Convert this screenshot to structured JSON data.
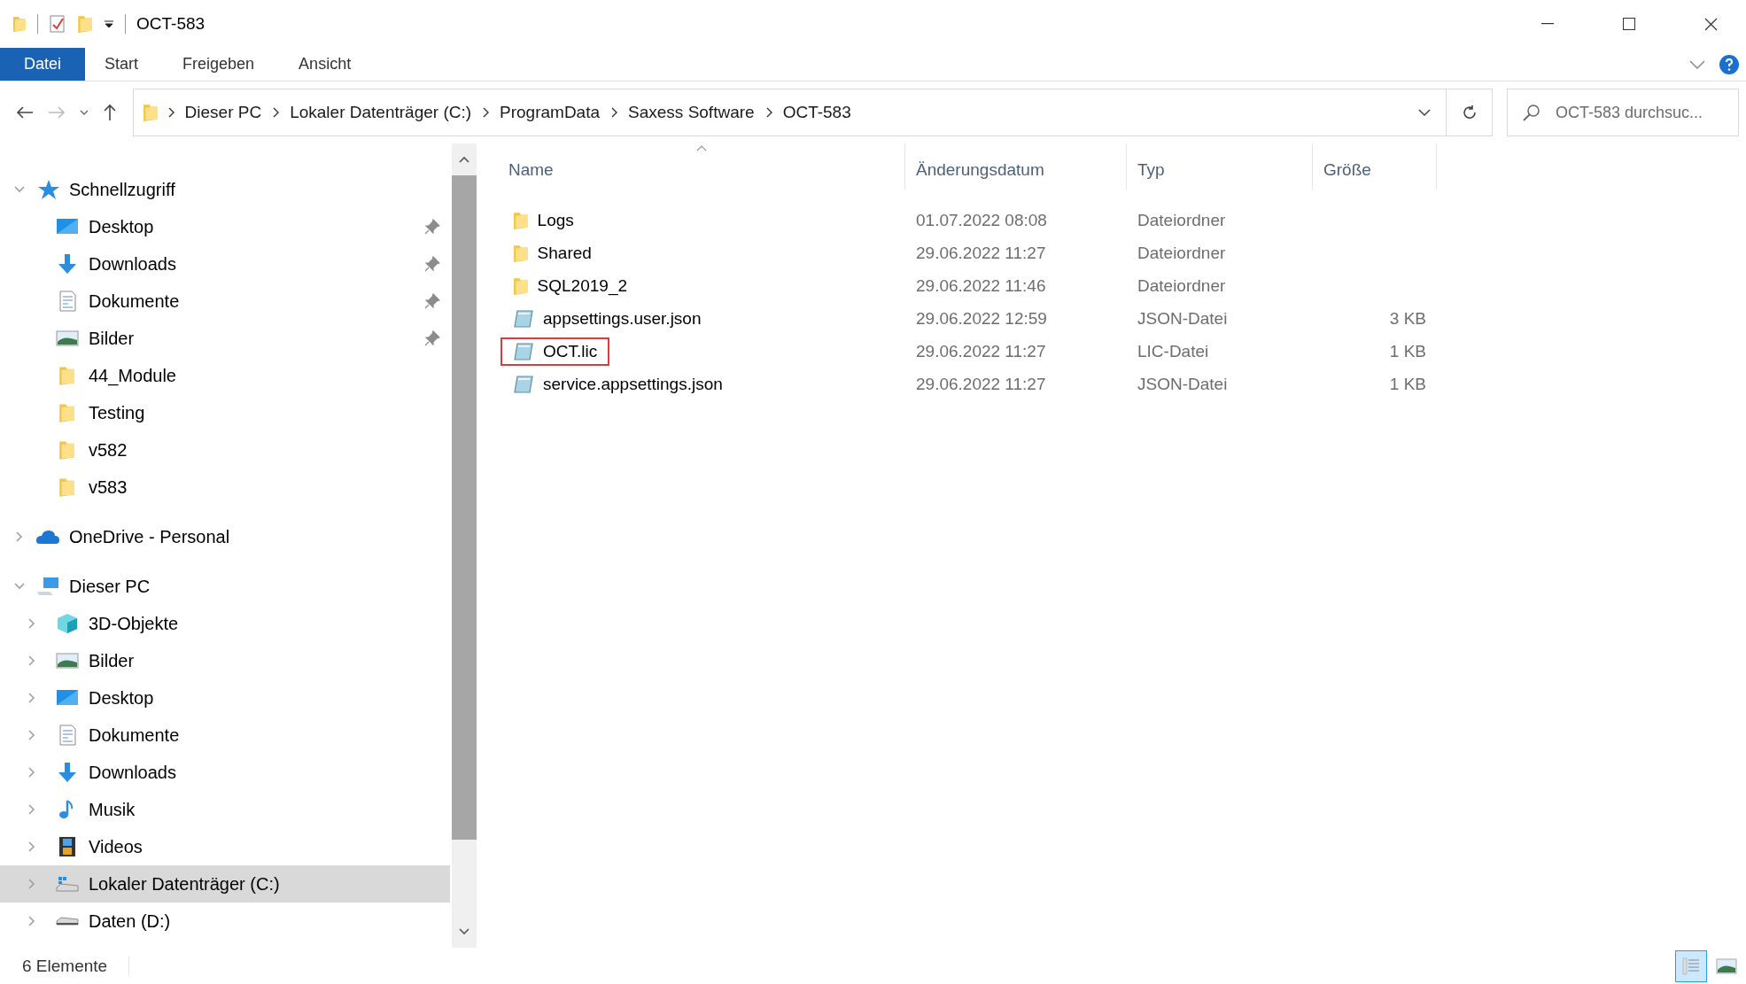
{
  "window": {
    "title": "OCT-583"
  },
  "ribbon_tabs": [
    {
      "label": "Datei",
      "kind": "file"
    },
    {
      "label": "Start",
      "kind": "tab"
    },
    {
      "label": "Freigeben",
      "kind": "tab"
    },
    {
      "label": "Ansicht",
      "kind": "tab"
    }
  ],
  "address_bar": {
    "segments": [
      "Dieser PC",
      "Lokaler Datenträger (C:)",
      "ProgramData",
      "Saxess Software",
      "OCT-583"
    ]
  },
  "search": {
    "placeholder": "OCT-583 durchsuc..."
  },
  "sidebar": {
    "items": [
      {
        "label": "Schnellzugriff",
        "kind": "star",
        "expanded": true,
        "selected": false,
        "children": [
          {
            "label": "Desktop",
            "kind": "desktop",
            "pinned": true,
            "selected": false
          },
          {
            "label": "Downloads",
            "kind": "downloads",
            "pinned": true,
            "selected": false
          },
          {
            "label": "Dokumente",
            "kind": "documents",
            "pinned": true,
            "selected": false
          },
          {
            "label": "Bilder",
            "kind": "pictures",
            "pinned": true,
            "selected": false
          },
          {
            "label": "44_Module",
            "kind": "folder",
            "pinned": false,
            "selected": false
          },
          {
            "label": "Testing",
            "kind": "folder",
            "pinned": false,
            "selected": false
          },
          {
            "label": "v582",
            "kind": "folder",
            "pinned": false,
            "selected": false
          },
          {
            "label": "v583",
            "kind": "folder",
            "pinned": false,
            "selected": false
          }
        ]
      },
      {
        "label": "OneDrive - Personal",
        "kind": "cloud",
        "expanded": false,
        "selected": false
      },
      {
        "label": "Dieser PC",
        "kind": "pc",
        "expanded": true,
        "selected": false,
        "children": [
          {
            "label": "3D-Objekte",
            "kind": "cube",
            "expanded": false,
            "selected": false
          },
          {
            "label": "Bilder",
            "kind": "pictures",
            "expanded": false,
            "selected": false
          },
          {
            "label": "Desktop",
            "kind": "desktop",
            "expanded": false,
            "selected": false
          },
          {
            "label": "Dokumente",
            "kind": "documents",
            "expanded": false,
            "selected": false
          },
          {
            "label": "Downloads",
            "kind": "downloads",
            "expanded": false,
            "selected": false
          },
          {
            "label": "Musik",
            "kind": "music",
            "expanded": false,
            "selected": false
          },
          {
            "label": "Videos",
            "kind": "videos",
            "expanded": false,
            "selected": false
          },
          {
            "label": "Lokaler Datenträger (C:)",
            "kind": "system_drive",
            "expanded": false,
            "selected": true
          },
          {
            "label": "Daten (D:)",
            "kind": "drive",
            "expanded": false,
            "selected": false
          }
        ]
      }
    ]
  },
  "file_list": {
    "columns": [
      {
        "label": "Name",
        "sorted": true
      },
      {
        "label": "Änderungsdatum",
        "sorted": false
      },
      {
        "label": "Typ",
        "sorted": false
      },
      {
        "label": "Größe",
        "sorted": false
      }
    ],
    "rows": [
      {
        "name": "Logs",
        "date": "01.07.2022 08:08",
        "type": "Dateiordner",
        "kind": "folder",
        "selected": false,
        "highlighted": false
      },
      {
        "name": "Shared",
        "date": "29.06.2022 11:27",
        "type": "Dateiordner",
        "kind": "folder",
        "selected": false,
        "highlighted": false
      },
      {
        "name": "SQL2019_2",
        "date": "29.06.2022 11:46",
        "type": "Dateiordner",
        "kind": "folder",
        "selected": false,
        "highlighted": false
      },
      {
        "name": "appsettings.user.json",
        "date": "29.06.2022 12:59",
        "type": "JSON-Datei",
        "size": "3 KB",
        "kind": "file",
        "selected": false,
        "highlighted": false
      },
      {
        "name": "OCT.lic",
        "date": "29.06.2022 11:27",
        "type": "LIC-Datei",
        "size": "1 KB",
        "kind": "file",
        "selected": false,
        "highlighted": true
      },
      {
        "name": "service.appsettings.json",
        "date": "29.06.2022 11:27",
        "type": "JSON-Datei",
        "size": "1 KB",
        "kind": "file",
        "selected": false,
        "highlighted": false
      }
    ]
  },
  "status_bar": {
    "count": "6 Elemente",
    "view_buttons": [
      {
        "kind": "details",
        "selected": true
      },
      {
        "kind": "large_icons",
        "selected": false
      }
    ]
  }
}
